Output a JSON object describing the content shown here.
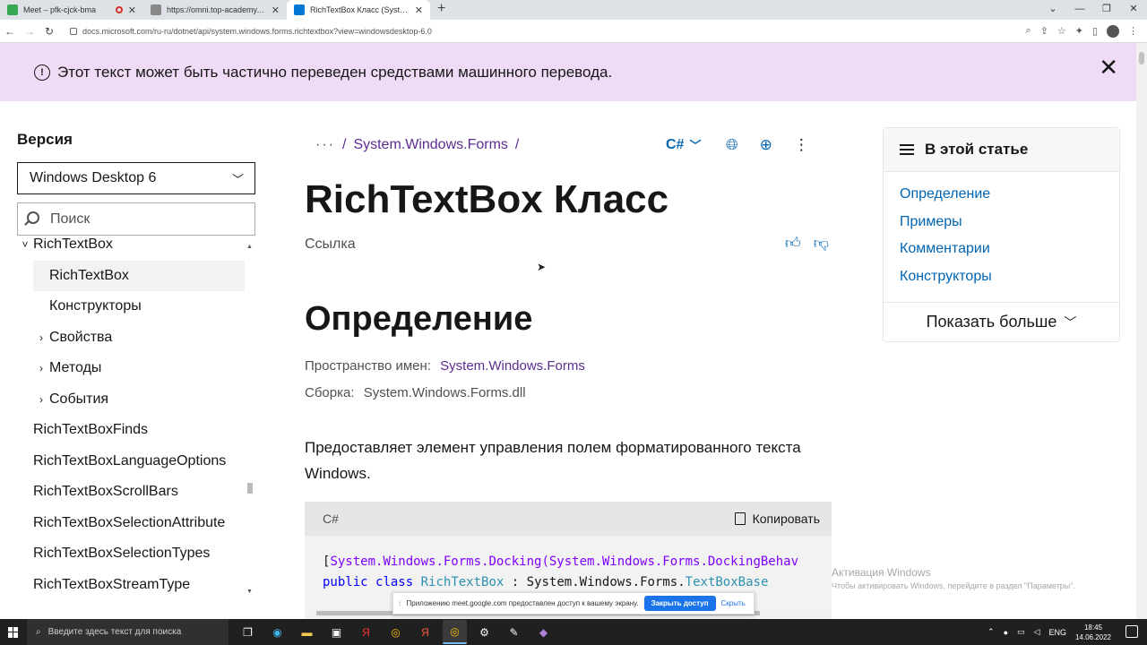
{
  "browser": {
    "tabs": [
      {
        "title": "Meet – pfk-cjck-bma",
        "color": "#34a853"
      },
      {
        "title": "https://omni.top-academy.ru/#/p",
        "color": "#888888"
      },
      {
        "title": "RichTextBox Класс (System.Windo",
        "color": "#0078d4"
      }
    ],
    "url": "docs.microsoft.com/ru-ru/dotnet/api/system.windows.forms.richtextbox?view=windowsdesktop-6.0"
  },
  "banner": {
    "text": "Этот текст может быть частично переведен средствами машинного перевода."
  },
  "sidebar": {
    "version_label": "Версия",
    "version_value": "Windows Desktop 6",
    "search_placeholder": "Поиск",
    "items": [
      {
        "label": "RichTextBox",
        "indent": 1,
        "expander": "˅",
        "selected": false
      },
      {
        "label": "RichTextBox",
        "indent": 2,
        "expander": "",
        "selected": true
      },
      {
        "label": "Конструкторы",
        "indent": 2,
        "expander": "",
        "selected": false
      },
      {
        "label": "Свойства",
        "indent": 2,
        "expander": "›",
        "selected": false
      },
      {
        "label": "Методы",
        "indent": 2,
        "expander": "›",
        "selected": false
      },
      {
        "label": "События",
        "indent": 2,
        "expander": "›",
        "selected": false
      },
      {
        "label": "RichTextBoxFinds",
        "indent": 1,
        "expander": "",
        "selected": false
      },
      {
        "label": "RichTextBoxLanguageOptions",
        "indent": 1,
        "expander": "",
        "selected": false
      },
      {
        "label": "RichTextBoxScrollBars",
        "indent": 1,
        "expander": "",
        "selected": false
      },
      {
        "label": "RichTextBoxSelectionAttribute",
        "indent": 1,
        "expander": "",
        "selected": false
      },
      {
        "label": "RichTextBoxSelectionTypes",
        "indent": 1,
        "expander": "",
        "selected": false
      },
      {
        "label": "RichTextBoxStreamType",
        "indent": 1,
        "expander": "",
        "selected": false
      }
    ]
  },
  "content": {
    "breadcrumb_dots": "···",
    "breadcrumb_sep": "/",
    "breadcrumb_item": "System.Windows.Forms",
    "language": "C#",
    "title": "RichTextBox Класс",
    "reference": "Ссылка",
    "definition_heading": "Определение",
    "namespace_label": "Пространство имен:",
    "namespace_value": "System.Windows.Forms",
    "assembly_label": "Сборка:",
    "assembly_value": "System.Windows.Forms.dll",
    "description": "Предоставляет элемент управления полем форматированного текста Windows.",
    "code_lang": "C#",
    "copy_label": "Копировать",
    "code_line1_attr": "System.Windows.Forms.Docking(System.Windows.Forms.DockingBehav",
    "code_line2_kw1": "public",
    "code_line2_kw2": "class",
    "code_line2_name": "RichTextBox",
    "code_line2_sep": ":",
    "code_line2_base_ns": "System.Windows.Forms.",
    "code_line2_base": "TextBoxBase"
  },
  "onpage": {
    "heading": "В этой статье",
    "links": [
      "Определение",
      "Примеры",
      "Комментарии",
      "Конструкторы"
    ],
    "show_more": "Показать больше"
  },
  "watermark": {
    "line1": "Активация Windows",
    "line2": "Чтобы активировать Windows, перейдите в раздел \"Параметры\"."
  },
  "share_bar": {
    "text": "Приложению meet.google.com предоставлен доступ к вашему экрану.",
    "stop": "Закрыть доступ",
    "hide": "Скрыть"
  },
  "taskbar": {
    "search_placeholder": "Введите здесь текст для поиска",
    "lang": "ENG",
    "time": "18:45",
    "date": "14.06.2022"
  }
}
